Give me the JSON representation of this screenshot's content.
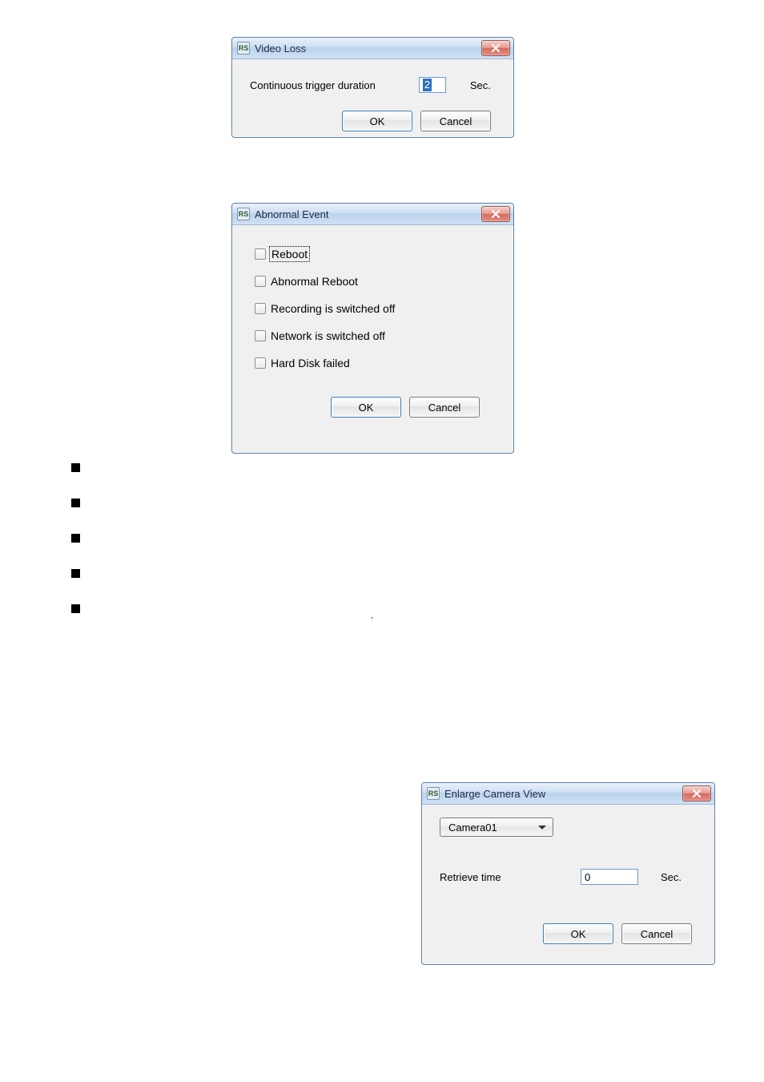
{
  "video_loss": {
    "title": "Video Loss",
    "label": "Continuous trigger duration",
    "value": "2",
    "unit": "Sec.",
    "ok": "OK",
    "cancel": "Cancel"
  },
  "abnormal": {
    "title": "Abnormal Event",
    "items": [
      {
        "label": "Reboot",
        "checked": false,
        "focused": true
      },
      {
        "label": "Abnormal Reboot",
        "checked": false,
        "focused": false
      },
      {
        "label": "Recording is switched off",
        "checked": false,
        "focused": false
      },
      {
        "label": "Network is switched off",
        "checked": false,
        "focused": false
      },
      {
        "label": "Hard Disk failed",
        "checked": false,
        "focused": false
      }
    ],
    "ok": "OK",
    "cancel": "Cancel"
  },
  "enlarge": {
    "title": "Enlarge Camera View",
    "camera": "Camera01",
    "retrieve_label": "Retrieve time",
    "retrieve_value": "0",
    "unit": "Sec.",
    "ok": "OK",
    "cancel": "Cancel"
  },
  "icons": {
    "app": "RS"
  },
  "tiny": ","
}
